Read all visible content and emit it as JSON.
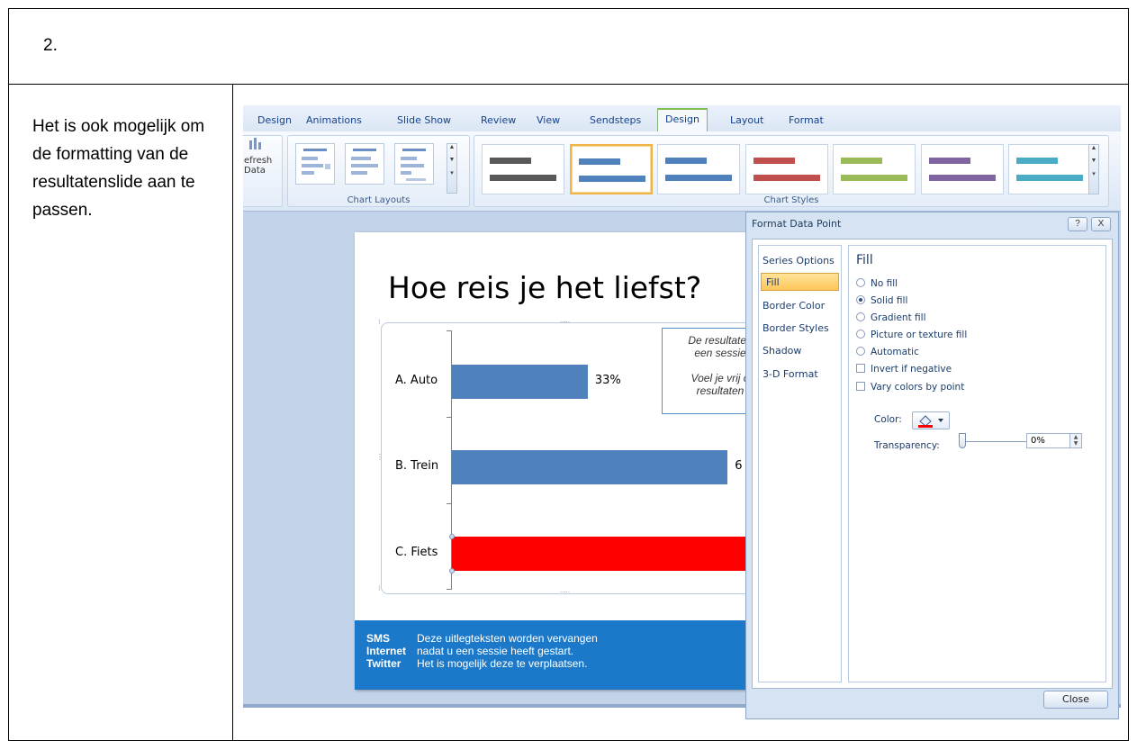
{
  "step": {
    "number": "2."
  },
  "description": "Het is ook mogelijk om de formatting van de resultatenslide aan te passen.",
  "ribbon": {
    "tabs": [
      "Design",
      "Animations",
      "Slide Show",
      "Review",
      "View",
      "Sendsteps",
      "Design",
      "Layout",
      "Format"
    ],
    "active_tab_index": 6,
    "refresh_label_1": "efresh",
    "refresh_label_2": "Data",
    "chart_layouts_label": "Chart Layouts",
    "chart_styles_label": "Chart Styles",
    "style_colors": [
      "#595959",
      "#4f81bd",
      "#4f81bd",
      "#c0504d",
      "#9bbb59",
      "#8064a2",
      "#4bacc6"
    ],
    "selected_style_index": 1
  },
  "slide": {
    "title": "Hoe reis je het liefst?",
    "note_lines": [
      "De resultaten",
      "een sessie",
      "Voel je vrij o",
      "resultaten"
    ],
    "footer": [
      {
        "key": "SMS",
        "text": "Deze uitlegteksten worden vervangen"
      },
      {
        "key": "Internet",
        "text": "nadat u een sessie heeft gestart."
      },
      {
        "key": "Twitter",
        "text": "Het is mogelijk deze te verplaatsen."
      }
    ],
    "handle_dots": "....."
  },
  "chart_data": {
    "type": "bar",
    "orientation": "horizontal",
    "categories": [
      "A. Auto",
      "B. Trein",
      "C. Fiets"
    ],
    "values": [
      33,
      67,
      100
    ],
    "data_labels": [
      "33%",
      "6",
      ""
    ],
    "colors": [
      "#4f81bd",
      "#4f81bd",
      "#ff0000"
    ],
    "title": "",
    "xlabel": "",
    "ylabel": "",
    "xlim": [
      0,
      70
    ]
  },
  "dialog": {
    "title": "Format Data Point",
    "help_label": "?",
    "close_x_label": "X",
    "nav": [
      "Series Options",
      "Fill",
      "Border Color",
      "Border Styles",
      "Shadow",
      "3-D Format"
    ],
    "selected_nav_index": 1,
    "panel_heading": "Fill",
    "radio_options": [
      "No fill",
      "Solid fill",
      "Gradient fill",
      "Picture or texture fill",
      "Automatic"
    ],
    "selected_radio_index": 1,
    "checkboxes": [
      "Invert if negative",
      "Vary colors by point"
    ],
    "color_label": "Color:",
    "color_value": "#ff0000",
    "transparency_label": "Transparency:",
    "transparency_value": "0%",
    "close_button": "Close"
  }
}
